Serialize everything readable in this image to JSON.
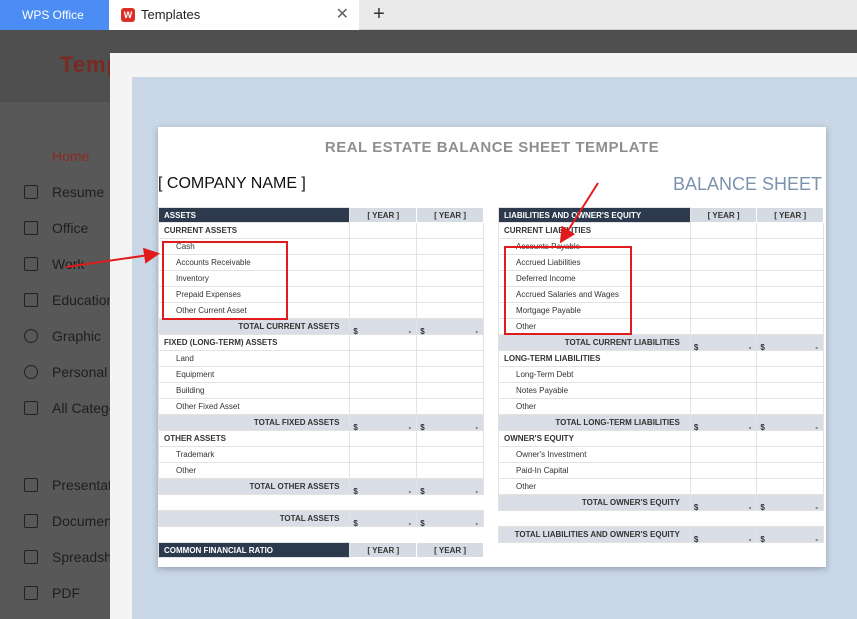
{
  "tabs": {
    "wps": "WPS Office",
    "templates": "Templates",
    "close": "✕",
    "plus": "+"
  },
  "brand": "Temp",
  "sidebar": [
    {
      "label": "Home"
    },
    {
      "label": "Resume"
    },
    {
      "label": "Office"
    },
    {
      "label": "Work"
    },
    {
      "label": "Education"
    },
    {
      "label": "Graphic"
    },
    {
      "label": "Personal"
    },
    {
      "label": "All Catego"
    },
    {
      "label": "Presentatio"
    },
    {
      "label": "Document"
    },
    {
      "label": "Spreadsheet"
    },
    {
      "label": "PDF"
    }
  ],
  "sheet": {
    "title": "REAL ESTATE BALANCE SHEET TEMPLATE",
    "company": "[ COMPANY NAME ]",
    "balance": "BALANCE SHEET",
    "year": "[ YEAR ]",
    "currency": "$",
    "dash": "-",
    "left": {
      "header": "ASSETS",
      "current_head": "CURRENT ASSETS",
      "current": [
        "Cash",
        "Accounts Receivable",
        "Inventory",
        "Prepaid Expenses",
        "Other Current Asset"
      ],
      "total_current": "TOTAL CURRENT ASSETS",
      "fixed_head": "FIXED (LONG-TERM) ASSETS",
      "fixed": [
        "Land",
        "Equipment",
        "Building",
        "Other Fixed Asset"
      ],
      "total_fixed": "TOTAL FIXED ASSETS",
      "other_head": "OTHER ASSETS",
      "other": [
        "Trademark",
        "Other"
      ],
      "total_other": "TOTAL OTHER ASSETS",
      "total_assets": "TOTAL ASSETS",
      "ratio_head": "COMMON FINANCIAL RATIO"
    },
    "right": {
      "header": "LIABILITIES AND OWNER'S EQUITY",
      "current_head": "CURRENT LIABILITIES",
      "current": [
        "Accounts Payable",
        "Accrued Liabilities",
        "Deferred Income",
        "Accrued Salaries and Wages",
        "Mortgage Payable",
        "Other"
      ],
      "total_current": "TOTAL CURRENT LIABILITIES",
      "long_head": "LONG-TERM LIABILITIES",
      "long": [
        "Long-Term Debt",
        "Notes Payable",
        "Other"
      ],
      "total_long": "TOTAL LONG-TERM LIABILITIES",
      "equity_head": "OWNER'S EQUITY",
      "equity": [
        "Owner's Investment",
        "Paid-In Capital",
        "Other"
      ],
      "total_equity": "TOTAL OWNER'S EQUITY",
      "total_all": "TOTAL LIABILITIES AND OWNER'S EQUITY"
    }
  }
}
